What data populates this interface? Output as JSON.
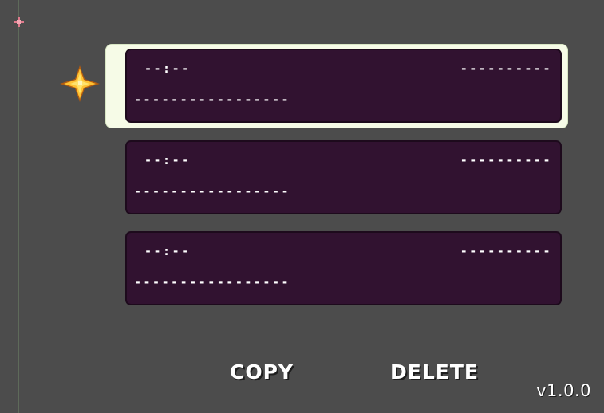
{
  "save_slots": [
    {
      "time": "--:--",
      "timestamp": "----------",
      "name": "-----------------",
      "selected": true
    },
    {
      "time": "--:--",
      "timestamp": "----------",
      "name": "-----------------",
      "selected": false
    },
    {
      "time": "--:--",
      "timestamp": "----------",
      "name": "-----------------",
      "selected": false
    }
  ],
  "actions": {
    "copy_label": "COPY",
    "delete_label": "DELETE"
  },
  "version": "v1.0.0",
  "icons": {
    "cursor": "sparkle-star-icon",
    "origin": "origin-crosshair-icon"
  },
  "colors": {
    "background": "#4c4c4c",
    "slot_fill": "#311230",
    "selection_frame": "#f6fbe7",
    "cursor_star": "#ffd23c"
  }
}
